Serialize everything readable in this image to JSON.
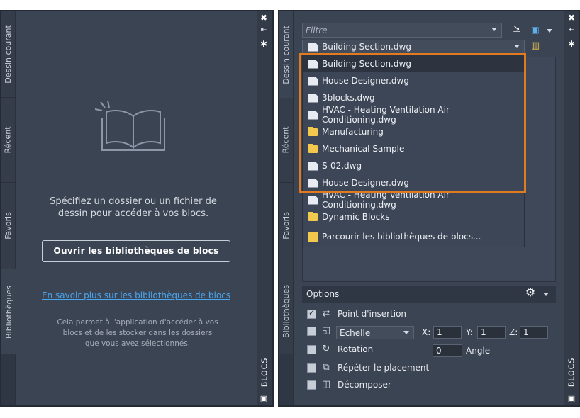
{
  "left": {
    "tabs": [
      "Dessin courant",
      "Récent",
      "Favoris",
      "Bibliothèques"
    ],
    "palette_title": "BLOCS",
    "icons": {
      "close": "close-icon",
      "pin": "pin-icon",
      "settings": "settings-icon"
    },
    "message": "Spécifiez un dossier ou un fichier de dessin pour accéder à vos blocs.",
    "open_button": "Ouvrir les bibliothèques de blocs",
    "learn_more": "En savoir plus sur les bibliothèques de blocs",
    "description": "Cela permet à l'application d'accéder à vos blocs et de les stocker dans les dossiers que vous avez sélectionnés."
  },
  "right": {
    "tabs": [
      "Dessin courant",
      "Récent",
      "Favoris",
      "Bibliothèques"
    ],
    "palette_title": "BLOCS",
    "filter_placeholder": "Filtre",
    "library_value": "Building Section.dwg",
    "dropdown_items": [
      {
        "label": "Building Section.dwg",
        "kind": "file"
      },
      {
        "label": "House Designer.dwg",
        "kind": "file"
      },
      {
        "label": "3blocks.dwg",
        "kind": "file"
      },
      {
        "label": "HVAC - Heating Ventilation Air Conditioning.dwg",
        "kind": "file"
      },
      {
        "label": "Manufacturing",
        "kind": "folder"
      },
      {
        "label": "Mechanical Sample",
        "kind": "folder"
      },
      {
        "label": "S-02.dwg",
        "kind": "file"
      },
      {
        "label": "House Designer.dwg",
        "kind": "file"
      },
      {
        "label": "HVAC - Heating Ventilation Air Conditioning.dwg",
        "kind": "file"
      },
      {
        "label": "Dynamic Blocks",
        "kind": "folder"
      }
    ],
    "browse_label": "Parcourir les bibliothèques de blocs...",
    "options": {
      "title": "Options",
      "insertion_point": "Point d'insertion",
      "scale_value": "Echelle",
      "x_label": "X:",
      "x_value": "1",
      "y_label": "Y:",
      "y_value": "1",
      "z_label": "Z:",
      "z_value": "1",
      "rotation": "Rotation",
      "angle_value": "0",
      "angle_label": "Angle",
      "repeat": "Répéter le placement",
      "explode": "Décomposer"
    },
    "highlight_color": "#e27a1f"
  }
}
